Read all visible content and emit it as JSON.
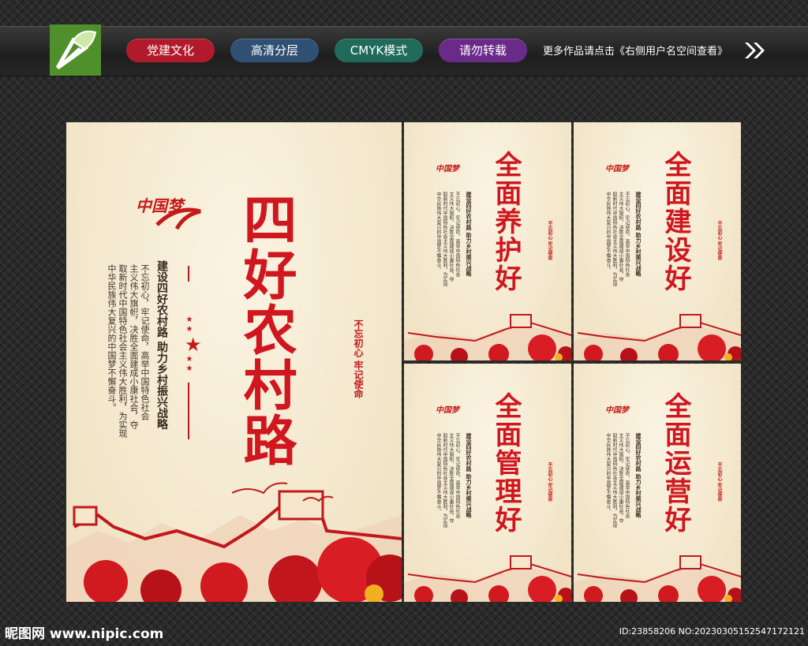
{
  "header": {
    "tags": [
      {
        "label": "党建文化",
        "color": "#b01a2a"
      },
      {
        "label": "高清分层",
        "color": "#2f4f73"
      },
      {
        "label": "CMYK模式",
        "color": "#1f6a5a"
      },
      {
        "label": "请勿转载",
        "color": "#6a2a8a"
      }
    ],
    "promo_text": "更多作品请点击《右侧用户名空间查看》"
  },
  "colors": {
    "accent_red": "#d0171f",
    "paper": "#f4e8cc",
    "logo_green": "#4f8f2c"
  },
  "posters": {
    "main": {
      "brand": "中国梦",
      "title": "四好农村路",
      "subtitle": "建设四好农村路 助力乡村振兴战略",
      "body_lines": [
        "不忘初心，牢记使命，高举中国特色社会",
        "主义伟大旗帜，决胜全面建成小康社会，夺",
        "取新时代中国特色社会主义伟大胜利，为实现",
        "中华民族伟大复兴的中国梦不懈奋斗。"
      ],
      "slogan": "不忘初心 牢记使命"
    },
    "small": [
      {
        "title": "全面养护好"
      },
      {
        "title": "全面建设好"
      },
      {
        "title": "全面管理好"
      },
      {
        "title": "全面运营好"
      }
    ],
    "small_common": {
      "brand": "中国梦",
      "subtitle": "建设四好农村路 助力乡村振兴战略",
      "body_lines": [
        "不忘初心，牢记使命，高举中国特色社会",
        "主义伟大旗帜，决胜全面建成小康社会，夺",
        "取新时代中国特色社会主义伟大胜利，为实现",
        "中华民族伟大复兴的中国梦不懈奋斗。"
      ],
      "slogan": "不忘初心 牢记使命"
    }
  },
  "footer": {
    "site": "昵图网 www.nipic.com",
    "id_text": "ID:23858206 NO:20230305152547172121"
  }
}
